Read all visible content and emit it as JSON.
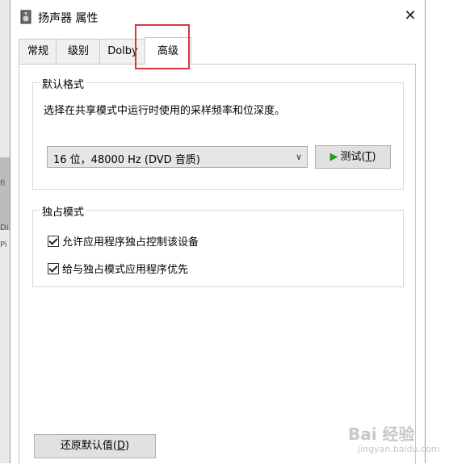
{
  "window": {
    "title": "扬声器 属性",
    "close_glyph": "✕"
  },
  "tabs": [
    {
      "label": "常规"
    },
    {
      "label": "级别"
    },
    {
      "label": "Dolby"
    },
    {
      "label": "高级"
    }
  ],
  "default_format": {
    "group_label": "默认格式",
    "description": "选择在共享模式中运行时使用的采样频率和位深度。",
    "selected_format": "16 位，48000 Hz (DVD 音质)",
    "test_button": {
      "text": "测试(",
      "key": "T",
      "suffix": ")"
    }
  },
  "exclusive_mode": {
    "group_label": "独占模式",
    "option1": "允许应用程序独占控制该设备",
    "option2": "给与独占模式应用程序优先",
    "option1_checked": true,
    "option2_checked": true
  },
  "restore_button": {
    "text": "还原默认值(",
    "key": "D",
    "suffix": ")"
  },
  "left_strip": {
    "fragment1": "fi",
    "fragment2": "Di",
    "fragment3": "Pi"
  },
  "watermark": {
    "text": "Bai 经验",
    "sub": "jingyan.baidu.com"
  },
  "colors": {
    "highlight": "#d9363e",
    "play": "#1e9e1e"
  }
}
